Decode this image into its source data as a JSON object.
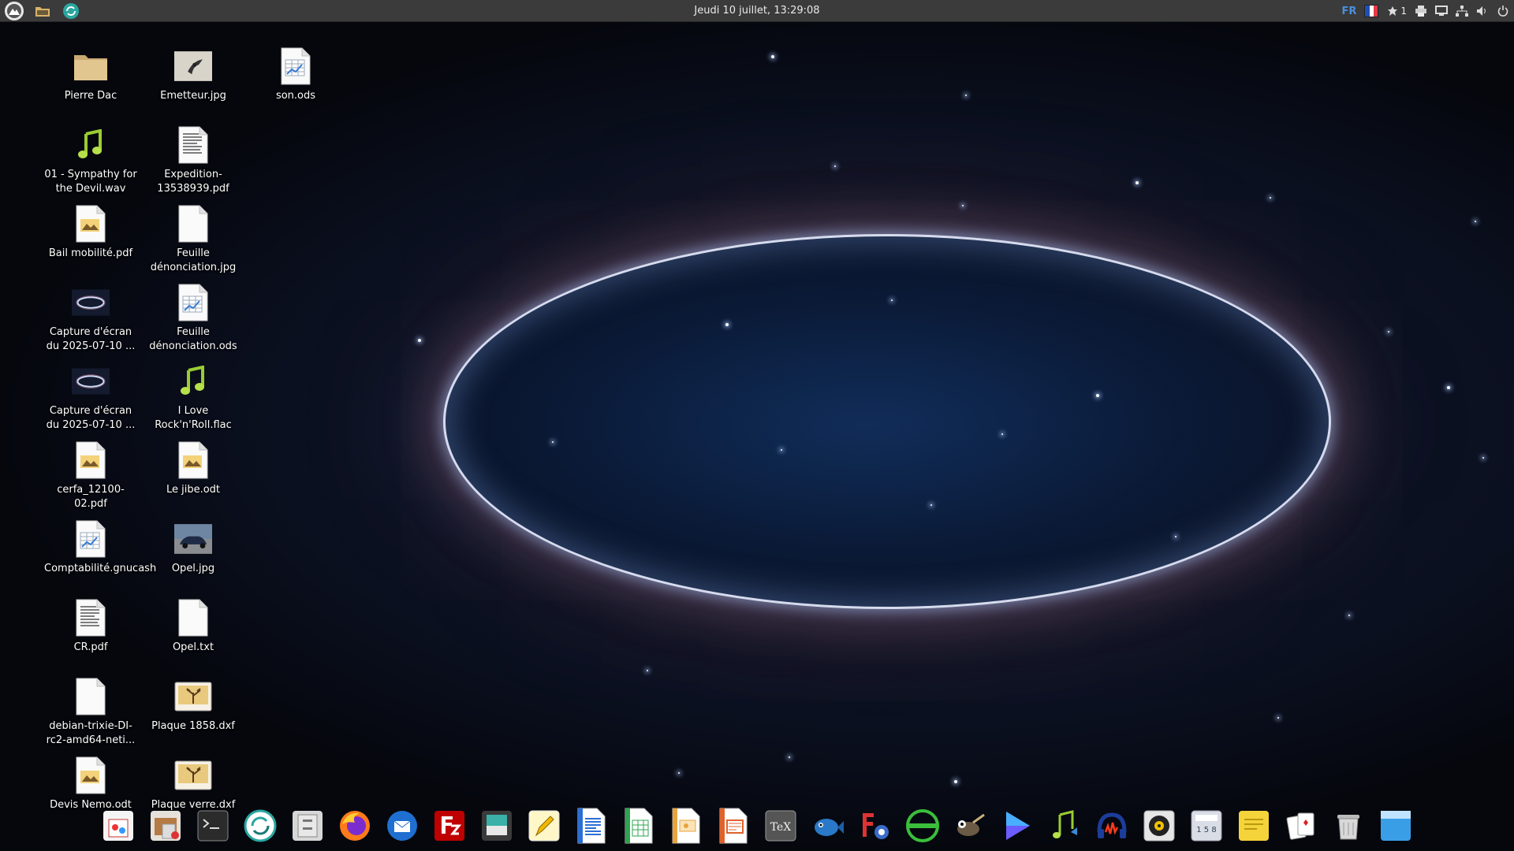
{
  "top_panel": {
    "clock": "Jeudi 10 juillet, 13:29:08",
    "language": "FR",
    "notification_count": "1",
    "icons": [
      "menu-icon",
      "folder-icon",
      "refresh-icon",
      "flag-icon",
      "notification-icon",
      "printer-icon",
      "display-icon",
      "network-icon",
      "volume-icon",
      "power-icon"
    ]
  },
  "desktop": {
    "col1": [
      {
        "label": "Pierre Dac",
        "icon": "folder-icon"
      },
      {
        "label": "01 - Sympathy for the Devil.wav",
        "icon": "audio-icon"
      },
      {
        "label": "Bail mobilité.pdf",
        "icon": "pdf-icon"
      },
      {
        "label": "Capture d'écran du 2025-07-10 ...",
        "icon": "screenshot-icon"
      },
      {
        "label": "Capture d'écran du 2025-07-10 ...",
        "icon": "screenshot-icon"
      },
      {
        "label": "cerfa_12100-02.pdf",
        "icon": "pdf-icon"
      },
      {
        "label": "Comptabilité.gnucash",
        "icon": "spreadsheet-icon"
      },
      {
        "label": "CR.pdf",
        "icon": "document-icon"
      },
      {
        "label": "debian-trixie-DI-rc2-amd64-neti...",
        "icon": "blank-file-icon"
      },
      {
        "label": "Devis Nemo.odt",
        "icon": "pdf-icon"
      }
    ],
    "col2": [
      {
        "label": "Emetteur.jpg",
        "icon": "image-icon"
      },
      {
        "label": "Expedition-13538939.pdf",
        "icon": "document-icon"
      },
      {
        "label": "Feuille dénonciation.jpg",
        "icon": "blank-file-icon"
      },
      {
        "label": "Feuille dénonciation.ods",
        "icon": "spreadsheet-icon"
      },
      {
        "label": "I Love Rock'n'Roll.flac",
        "icon": "audio-icon"
      },
      {
        "label": "Le jibe.odt",
        "icon": "pdf-icon"
      },
      {
        "label": "Opel.jpg",
        "icon": "car-image-icon"
      },
      {
        "label": "Opel.txt",
        "icon": "blank-file-icon"
      },
      {
        "label": "Plaque 1858.dxf",
        "icon": "dxf-icon"
      },
      {
        "label": "Plaque verre.dxf",
        "icon": "dxf-icon"
      }
    ],
    "col3": [
      {
        "label": "son.ods",
        "icon": "spreadsheet-icon"
      }
    ]
  },
  "dock": [
    "software-store-icon",
    "package-installer-icon",
    "terminal-icon",
    "refresh-app-icon",
    "file-cabinet-icon",
    "firefox-icon",
    "thunderbird-icon",
    "filezilla-icon",
    "tablet-icon",
    "text-editor-icon",
    "writer-icon",
    "calc-icon",
    "impress-icon",
    "draw-icon",
    "texmaker-icon",
    "fish-icon",
    "settings-icon",
    "network-manager-icon",
    "gimp-icon",
    "media-player-icon",
    "music-icon",
    "audacity-icon",
    "rhythmbox-icon",
    "calculator-icon",
    "sticky-notes-icon",
    "cards-icon",
    "trash-icon",
    "desktop-icon"
  ]
}
